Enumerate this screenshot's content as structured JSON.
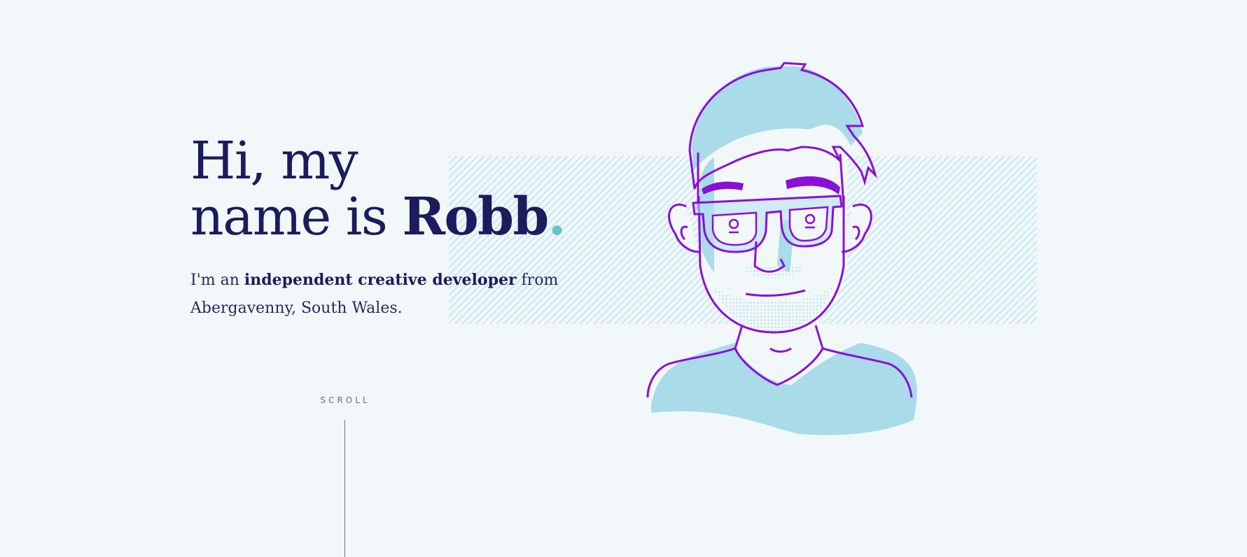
{
  "hero": {
    "line1": "Hi, my",
    "line2_prefix": "name is ",
    "name": "Robb",
    "dot": "."
  },
  "intro": {
    "prefix": "I'm an ",
    "strong": "independent creative developer",
    "suffix": " from Abergavenny, South Wales."
  },
  "avatar": {
    "icon": "developer-portrait-illustration"
  },
  "scroll": {
    "label": "SCROLL"
  },
  "colors": {
    "background": "#f2f8fa",
    "text": "#1d1a5e",
    "accent_dot": "#6cc2c8",
    "outline": "#8a0fd9",
    "fill": "#a9dbe9",
    "hatch": "#b7e2ef"
  }
}
